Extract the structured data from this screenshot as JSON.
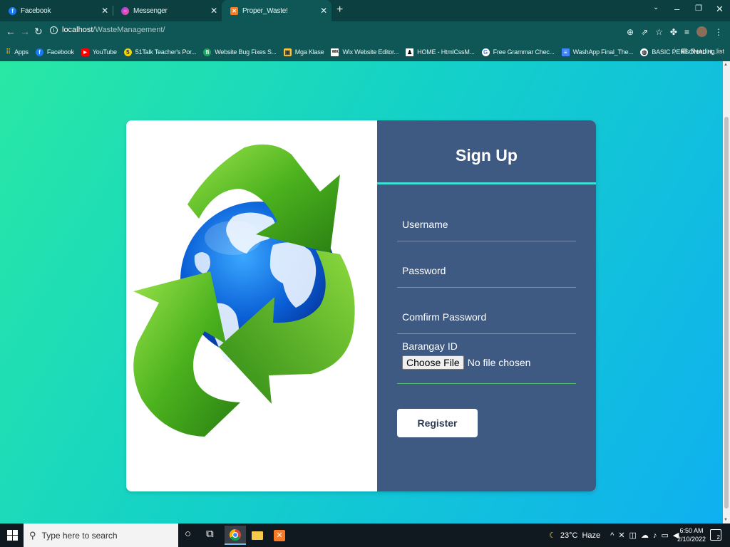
{
  "browser": {
    "tabs": [
      {
        "label": "Facebook",
        "icon": "facebook-icon"
      },
      {
        "label": "Messenger",
        "icon": "messenger-icon"
      },
      {
        "label": "Proper_Waste!",
        "icon": "xampp-icon"
      }
    ],
    "url": {
      "host": "localhost",
      "path": "/WasteManagement/"
    },
    "bookmarks": [
      "Apps",
      "Facebook",
      "YouTube",
      "51Talk Teacher's Por...",
      "Website Bug Fixes S...",
      "Mga Klase",
      "Wix Website Editor...",
      "HOME - HtmlCssM...",
      "Free Grammar Chec...",
      "WashApp Final_The...",
      "BASIC PERSONAL H..."
    ],
    "reading_list": "Reading list"
  },
  "form": {
    "title": "Sign Up",
    "username_placeholder": "Username",
    "password_placeholder": "Password",
    "confirm_placeholder": "Comfirm Password",
    "barangay_label": "Barangay ID",
    "choose_file": "Choose File",
    "no_file": "No file chosen",
    "register_label": "Register"
  },
  "taskbar": {
    "search_placeholder": "Type here to search",
    "temperature": "23°C",
    "weather": "Haze",
    "time": "6:50 AM",
    "date": "2/10/2022",
    "notification_count": "2"
  },
  "colors": {
    "chrome_dark": "#0b3f40",
    "chrome": "#0f5757",
    "form_panel": "#3e5a82",
    "accent_line": "#3ee0d8",
    "bg_gradient_start": "#29e8a4",
    "bg_gradient_end": "#0fb0f0"
  }
}
